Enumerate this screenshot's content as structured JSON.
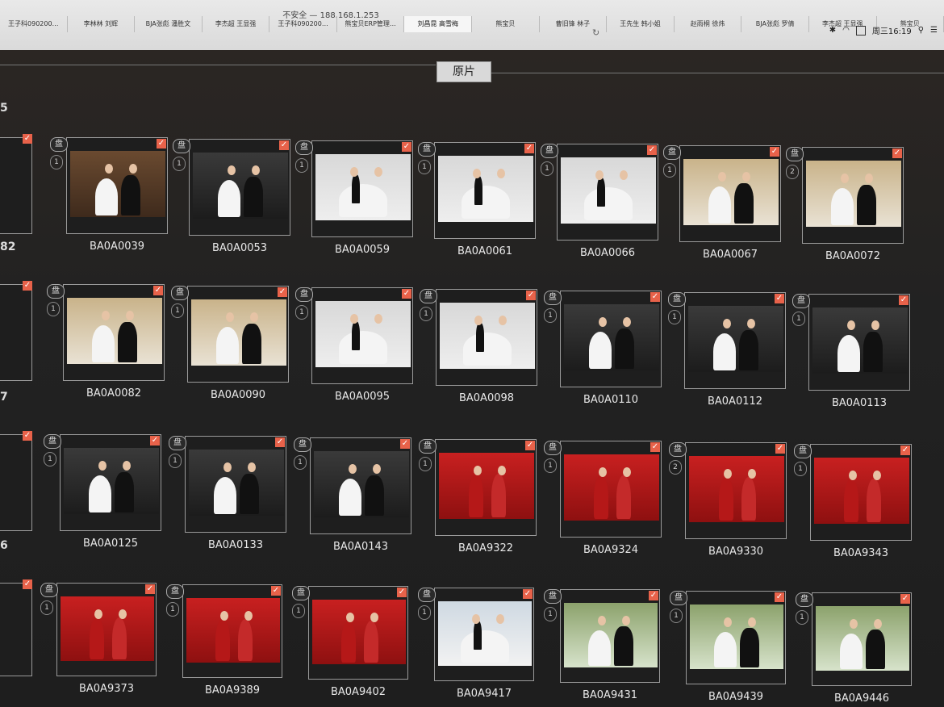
{
  "browser": {
    "url": "不安全 — 188.168.1.253",
    "tabs_row1": [
      "王子科090200…",
      "李林林 刘辉",
      "BJA张彪 潘胜文",
      "李杰超 王显强",
      "王子科090200…",
      "熊宝贝ERP管理…",
      "刘昌昆 高雪梅",
      "熊宝贝",
      "曹旧锋 林子",
      "王先生 韩小姐",
      "赵雨桐 徐炜",
      "BJA张彪 罗倩",
      "李杰超 王显强",
      "熊宝贝"
    ],
    "active_tab_index": 6,
    "clock": "周三16:19",
    "reload_icon": "reload-icon"
  },
  "toolbar": {
    "title": "原片"
  },
  "row_labels": [
    "5"
  ],
  "partial_left_labels": [
    "82",
    "7",
    "6"
  ],
  "photos": [
    {
      "code": "BA0A0039",
      "count": "1",
      "badge": "盘",
      "scene": "brown"
    },
    {
      "code": "BA0A0053",
      "count": "1",
      "badge": "盘",
      "scene": "dark"
    },
    {
      "code": "BA0A0059",
      "count": "1",
      "badge": "盘",
      "scene": "white"
    },
    {
      "code": "BA0A0061",
      "count": "1",
      "badge": "盘",
      "scene": "white"
    },
    {
      "code": "BA0A0066",
      "count": "1",
      "badge": "盘",
      "scene": "white"
    },
    {
      "code": "BA0A0067",
      "count": "1",
      "badge": "盘",
      "scene": "room"
    },
    {
      "code": "BA0A0072",
      "count": "2",
      "badge": "盘",
      "scene": "room"
    },
    {
      "code": "BA0A0082",
      "count": "1",
      "badge": "盘",
      "scene": "room"
    },
    {
      "code": "BA0A0090",
      "count": "1",
      "badge": "盘",
      "scene": "room"
    },
    {
      "code": "BA0A0095",
      "count": "1",
      "badge": "盘",
      "scene": "white"
    },
    {
      "code": "BA0A0098",
      "count": "1",
      "badge": "盘",
      "scene": "white"
    },
    {
      "code": "BA0A0110",
      "count": "1",
      "badge": "盘",
      "scene": "dark"
    },
    {
      "code": "BA0A0112",
      "count": "1",
      "badge": "盘",
      "scene": "dark"
    },
    {
      "code": "BA0A0113",
      "count": "1",
      "badge": "盘",
      "scene": "dark"
    },
    {
      "code": "BA0A0125",
      "count": "1",
      "badge": "盘",
      "scene": "dark"
    },
    {
      "code": "BA0A0133",
      "count": "1",
      "badge": "盘",
      "scene": "dark"
    },
    {
      "code": "BA0A0143",
      "count": "1",
      "badge": "盘",
      "scene": "dark"
    },
    {
      "code": "BA0A9322",
      "count": "1",
      "badge": "盘",
      "scene": "red"
    },
    {
      "code": "BA0A9324",
      "count": "1",
      "badge": "盘",
      "scene": "red"
    },
    {
      "code": "BA0A9330",
      "count": "2",
      "badge": "盘",
      "scene": "red"
    },
    {
      "code": "BA0A9343",
      "count": "1",
      "badge": "盘",
      "scene": "red"
    },
    {
      "code": "BA0A9373",
      "count": "1",
      "badge": "盘",
      "scene": "red"
    },
    {
      "code": "BA0A9389",
      "count": "1",
      "badge": "盘",
      "scene": "red"
    },
    {
      "code": "BA0A9402",
      "count": "1",
      "badge": "盘",
      "scene": "red"
    },
    {
      "code": "BA0A9417",
      "count": "1",
      "badge": "盘",
      "scene": "bluewhite"
    },
    {
      "code": "BA0A9431",
      "count": "1",
      "badge": "盘",
      "scene": "garden"
    },
    {
      "code": "BA0A9439",
      "count": "1",
      "badge": "盘",
      "scene": "garden"
    },
    {
      "code": "BA0A9446",
      "count": "1",
      "badge": "盘",
      "scene": "garden"
    }
  ],
  "checkmark": "✓",
  "colors": {
    "check": "#e8624a",
    "background": "#1a1a1a"
  }
}
